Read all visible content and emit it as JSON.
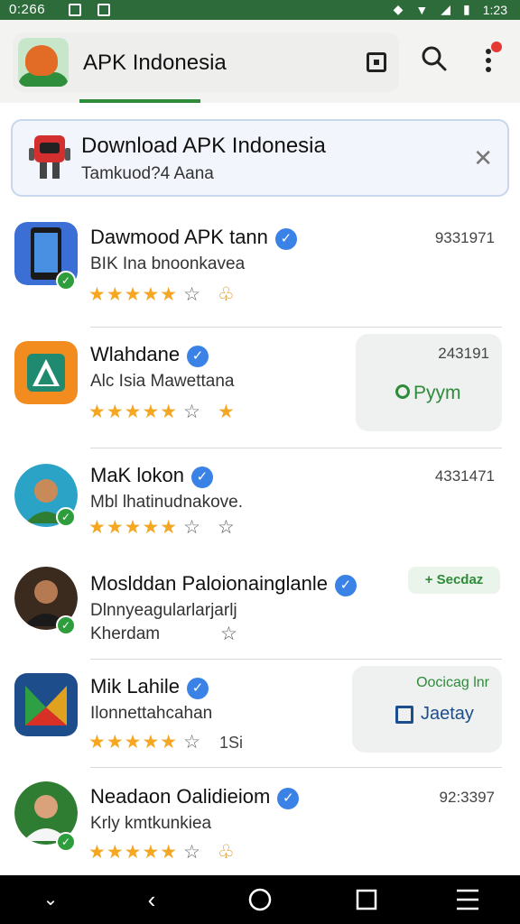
{
  "status_bar": {
    "time": "0:266",
    "clock": "1:23"
  },
  "app_bar": {
    "title": "APK Indonesia",
    "square_icon": "square-icon",
    "search_icon": "search-icon",
    "menu_icon": "more-vert-icon"
  },
  "banner": {
    "title": "Download APK Indonesia",
    "subtitle": "Tamkuod?4 Aana",
    "close_icon": "close-icon"
  },
  "rows": [
    {
      "title": "Dawmood APK tann",
      "subtitle": "BIK Ina bnoonkavea",
      "count": "9331971"
    },
    {
      "title": "Wlahdane",
      "subtitle": "Alc Isia Mawettana",
      "count": "243191",
      "action": "Pyym"
    },
    {
      "title": "MaK lokon",
      "subtitle": "Mbl lhatinudnakove.",
      "count": "4331471"
    },
    {
      "title": "Moslddan Paloionainglanle",
      "subtitle": "Dlnnyeagularlarjarlj",
      "subtitle2": "Kherdam",
      "pill": "+ Secdaz"
    },
    {
      "title": "Mik Lahile",
      "subtitle": "Ilonnettahcahan",
      "extra": "1Si",
      "top": "Oocicag lnr",
      "button": "Jaetay"
    },
    {
      "title": "Neadaon Oalidieiom",
      "subtitle": "Krly kmtkunkiea",
      "count": "92:3397"
    }
  ],
  "nav": {
    "down": "chevron-down-icon",
    "back": "back-icon",
    "home": "home-icon",
    "recents": "recents-icon",
    "menu": "menu-icon"
  }
}
